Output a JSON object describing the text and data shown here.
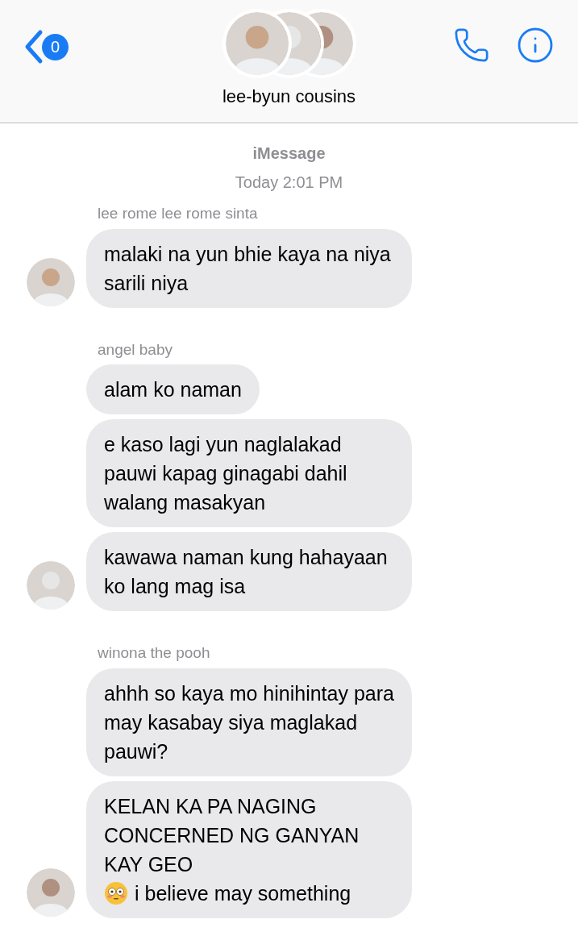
{
  "header": {
    "back_badge": "0",
    "title": "lee-byun cousins"
  },
  "thread": {
    "service": "iMessage",
    "timestamp": "Today 2:01 PM"
  },
  "groups": [
    {
      "sender": "lee rome lee rome sinta",
      "messages": [
        {
          "parts": [
            {
              "kind": "text",
              "text": "malaki na yun bhie kaya na niya sarili niya"
            }
          ]
        }
      ]
    },
    {
      "sender": "angel baby",
      "messages": [
        {
          "parts": [
            {
              "kind": "text",
              "text": "alam ko naman"
            }
          ]
        },
        {
          "parts": [
            {
              "kind": "text",
              "text": "e kaso lagi yun naglalakad pauwi kapag ginagabi dahil walang masakyan"
            }
          ]
        },
        {
          "parts": [
            {
              "kind": "text",
              "text": "kawawa naman kung hahayaan ko lang mag isa"
            }
          ]
        }
      ]
    },
    {
      "sender": "winona the pooh",
      "messages": [
        {
          "parts": [
            {
              "kind": "text",
              "text": "ahhh so kaya mo hinihintay para may kasabay siya maglakad pauwi?"
            }
          ]
        },
        {
          "parts": [
            {
              "kind": "text",
              "text": "KELAN KA PA NAGING CONCERNED NG GANYAN KAY GEO"
            },
            {
              "kind": "emoji"
            },
            {
              "kind": "text",
              "text": "i believe may something"
            }
          ]
        }
      ]
    }
  ]
}
